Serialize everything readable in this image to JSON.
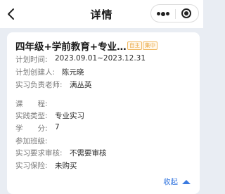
{
  "nav": {
    "title": "详情"
  },
  "course": {
    "title": "四年级+学前教育+专业…",
    "tags": [
      "自主",
      "集中"
    ]
  },
  "fields": {
    "plan_time": {
      "label": "计划时间:",
      "value": "2023.09.01~2023.12.31"
    },
    "creator": {
      "label": "计划创建人:",
      "value": "陈元晓"
    },
    "teacher": {
      "label": "实习负责老师:",
      "value": "满丛英"
    },
    "course": {
      "label": "课　　程:",
      "value": ""
    },
    "practice_type": {
      "label": "实践类型:",
      "value": "专业实习"
    },
    "credits": {
      "label": "学　　分:",
      "value": "7"
    },
    "class": {
      "label": "参加班级:",
      "value": ""
    },
    "review": {
      "label": "实习要求审核:",
      "value": "不需要审核"
    },
    "insurance": {
      "label": "实习保险:",
      "value": "未购买"
    }
  },
  "actions": {
    "collapse_label": "收起"
  }
}
